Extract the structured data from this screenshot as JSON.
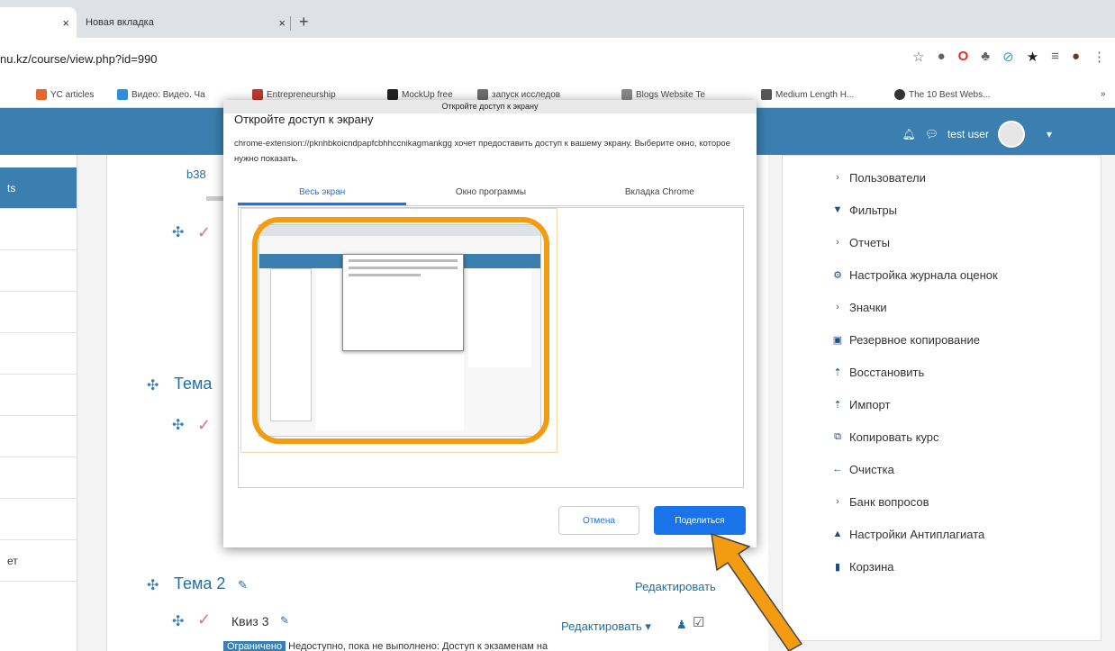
{
  "browser": {
    "tabs": [
      {
        "label": "",
        "close": "×"
      },
      {
        "label": "Новая вкладка",
        "close": "×"
      }
    ],
    "new_tab": "+",
    "url_host": "nu.kz",
    "url_path": "/course/view.php?id=990",
    "bookmarks": [
      {
        "label": "YC articles",
        "color": "#e6652a"
      },
      {
        "label": "Видео: Видео. Ча",
        "color": "#2f8fd8"
      },
      {
        "label": "Entrepreneurship",
        "color": "#c0392b"
      },
      {
        "label": "MockUp free",
        "color": "#222222"
      },
      {
        "label": "запуск исследов",
        "color": "#6d6d6d"
      },
      {
        "label": "Blogs Website Te",
        "color": "#888888"
      },
      {
        "label": "Medium Length H...",
        "color": "#555555"
      },
      {
        "label": "The 10 Best Webs...",
        "color": "#333333"
      }
    ],
    "more": "»"
  },
  "navbar": {
    "user_name": "test user",
    "caret": "▾"
  },
  "left_nav": {
    "items": [
      "ts",
      "",
      "",
      "",
      "",
      "",
      "",
      "",
      "",
      "ет",
      ""
    ]
  },
  "course": {
    "fragment": "b38",
    "topic_partial": "Тема",
    "topic2": "Тема 2",
    "quiz3": "Квиз 3",
    "edit": "Редактировать",
    "edit_menu": "Редактировать ▾",
    "restriction_badge": "Ограничено",
    "restriction_text": "Недоступно, пока не выполнено: Доступ к экзаменам на"
  },
  "admin_menu": {
    "items": [
      {
        "label": "Пользователи",
        "icon": "chevron-right"
      },
      {
        "label": "Фильтры",
        "icon": "filter"
      },
      {
        "label": "Отчеты",
        "icon": "chevron-right"
      },
      {
        "label": "Настройка журнала оценок",
        "icon": "gear"
      },
      {
        "label": "Значки",
        "icon": "chevron-right"
      },
      {
        "label": "Резервное копирование",
        "icon": "backup"
      },
      {
        "label": "Восстановить",
        "icon": "restore"
      },
      {
        "label": "Импорт",
        "icon": "import"
      },
      {
        "label": "Копировать курс",
        "icon": "copy"
      },
      {
        "label": "Очистка",
        "icon": "arrow-left"
      },
      {
        "label": "Банк вопросов",
        "icon": "chevron-right"
      },
      {
        "label": "Настройки Антиплагиата",
        "icon": "chart"
      },
      {
        "label": "Корзина",
        "icon": "trash"
      }
    ]
  },
  "dialog": {
    "caption": "Откройте доступ к экрану",
    "title": "Откройте доступ к экрану",
    "text": "chrome-extension://pknhbkoicndpapfcbhhccnikagmankgg хочет предоставить доступ к вашему экрану. Выберите окно, которое нужно показать.",
    "tabs": [
      "Весь экран",
      "Окно программы",
      "Вкладка Chrome"
    ],
    "cancel": "Отмена",
    "share": "Поделиться",
    "accent": "#1a73e8",
    "highlight": "#f39c12"
  }
}
